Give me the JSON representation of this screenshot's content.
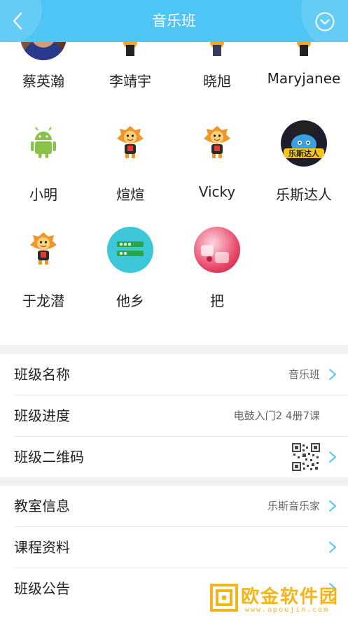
{
  "header": {
    "title": "音乐班"
  },
  "members": [
    {
      "name": "蔡英瀚",
      "avatar": "photo-avatar"
    },
    {
      "name": "李靖宇",
      "avatar": "lion-mascot-avatar"
    },
    {
      "name": "晓旭",
      "avatar": "lion-mascot-avatar"
    },
    {
      "name": "Maryjanee",
      "avatar": "lion-mascot-avatar"
    },
    {
      "name": "小明",
      "avatar": "android-avatar"
    },
    {
      "name": "煊煊",
      "avatar": "lion-mascot-avatar"
    },
    {
      "name": "Vicky",
      "avatar": "lion-mascot-avatar"
    },
    {
      "name": "乐斯达人",
      "avatar": "elephant-avatar"
    },
    {
      "name": "于龙潜",
      "avatar": "lion-mascot-avatar"
    },
    {
      "name": "他乡",
      "avatar": "teal-avatar"
    },
    {
      "name": "把",
      "avatar": "pink-ice-avatar"
    }
  ],
  "class_info": {
    "name_label": "班级名称",
    "name_value": "音乐班",
    "progress_label": "班级进度",
    "progress_value": "电鼓入门2 4册7课",
    "qr_label": "班级二维码"
  },
  "other_info": {
    "classroom_label": "教室信息",
    "classroom_value": "乐斯音乐家",
    "materials_label": "课程资料",
    "notice_label": "班级公告"
  },
  "elephant_avatar_text": "乐斯达人",
  "watermark": {
    "text": "欧金软件园",
    "url": "www.apoujin.com"
  },
  "colors": {
    "header": "#4ec5f5",
    "chevron": "#4ec5f5",
    "watermark": "#f4b41a"
  }
}
